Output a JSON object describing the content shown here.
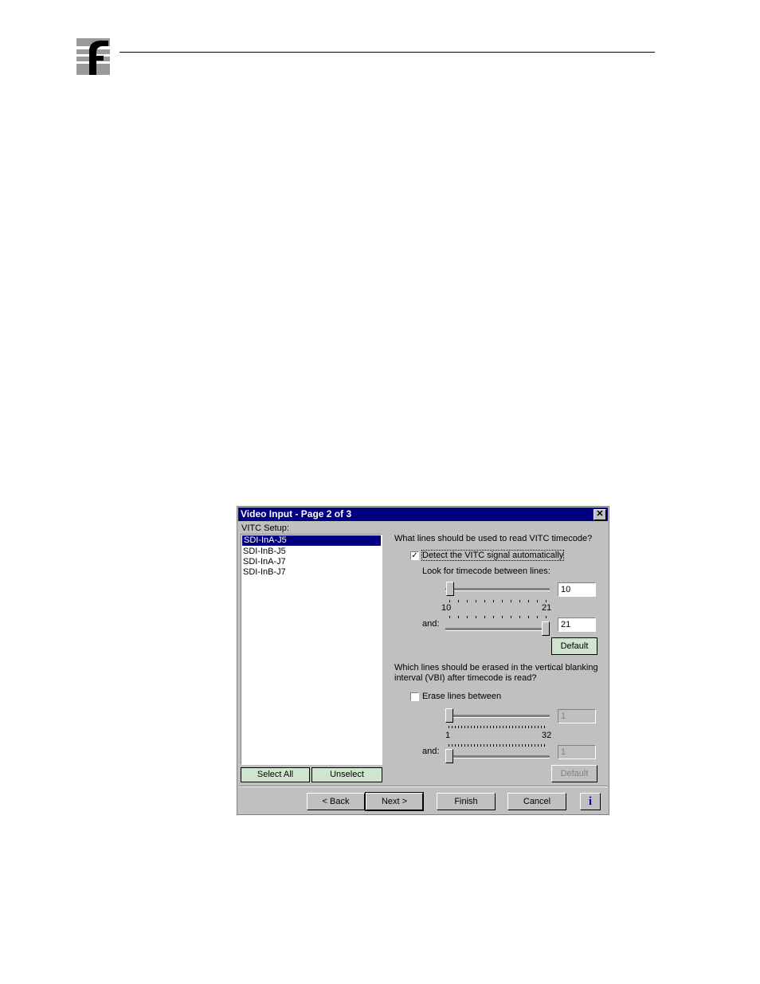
{
  "dialog": {
    "title": "Video Input - Page 2 of 3",
    "close_glyph": "✕",
    "vitc_setup_label": "VITC Setup:",
    "channels": [
      "SDI-InA-J5",
      "SDI-InB-J5",
      "SDI-InA-J7",
      "SDI-InB-J7"
    ],
    "select_all_label": "Select All",
    "unselect_label": "Unselect",
    "read_question": "What lines should be used to read VITC timecode?",
    "detect_checkbox_label": "Detect the VITC signal automatically",
    "detect_checked": true,
    "look_label": "Look for timecode between lines:",
    "read_slider": {
      "min_label": "10",
      "max_label": "21",
      "start_value": "10",
      "end_value": "21",
      "and_label": "and:"
    },
    "default_label": "Default",
    "erase_question_line1": "Which lines should be erased in the vertical blanking",
    "erase_question_line2": "interval (VBI) after timecode is read?",
    "erase_checkbox_label": "Erase lines between",
    "erase_checked": false,
    "erase_slider": {
      "min_label": "1",
      "max_label": "32",
      "start_value": "1",
      "end_value": "1",
      "and_label": "and:"
    },
    "erase_default_label": "Default",
    "buttons": {
      "back": "< Back",
      "next": "Next >",
      "finish": "Finish",
      "cancel": "Cancel",
      "info_glyph": "i"
    }
  }
}
